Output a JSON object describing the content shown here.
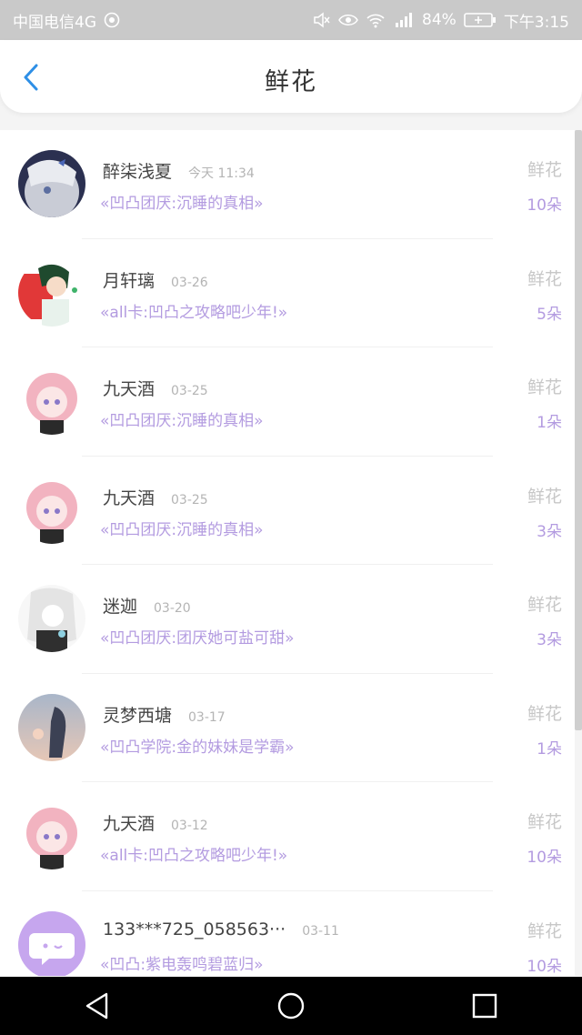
{
  "status_bar": {
    "carrier": "中国电信4G",
    "battery": "84%",
    "time": "下午3:15"
  },
  "header": {
    "title": "鲜花"
  },
  "colors": {
    "accent": "#2e8fe6",
    "work_text": "#b39be0"
  },
  "list": {
    "items": [
      {
        "name": "醉柒浅夏",
        "time": "今天 11:34",
        "work": "«凹凸团厌:沉睡的真相»",
        "label": "鲜花",
        "count": "10朵"
      },
      {
        "name": "月轩璃",
        "time": "03-26",
        "work": "«all卡:凹凸之攻略吧少年!»",
        "label": "鲜花",
        "count": "5朵"
      },
      {
        "name": "九天酒",
        "time": "03-25",
        "work": "«凹凸团厌:沉睡的真相»",
        "label": "鲜花",
        "count": "1朵"
      },
      {
        "name": "九天酒",
        "time": "03-25",
        "work": "«凹凸团厌:沉睡的真相»",
        "label": "鲜花",
        "count": "3朵"
      },
      {
        "name": "迷迦",
        "time": "03-20",
        "work": "«凹凸团厌:团厌她可盐可甜»",
        "label": "鲜花",
        "count": "3朵"
      },
      {
        "name": "灵梦西塘",
        "time": "03-17",
        "work": "«凹凸学院:金的妹妹是学霸»",
        "label": "鲜花",
        "count": "1朵"
      },
      {
        "name": "九天酒",
        "time": "03-12",
        "work": "«all卡:凹凸之攻略吧少年!»",
        "label": "鲜花",
        "count": "10朵"
      },
      {
        "name": "133***725_058563···",
        "time": "03-11",
        "work": "«凹凸:紫电轰鸣碧蓝归»",
        "label": "鲜花",
        "count": "10朵"
      }
    ]
  }
}
